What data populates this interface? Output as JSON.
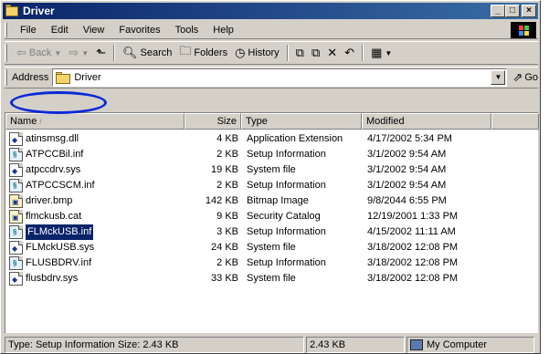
{
  "window": {
    "title": "Driver"
  },
  "title_buttons": {
    "minimize": "_",
    "maximize": "□",
    "close": "×"
  },
  "menu": [
    "File",
    "Edit",
    "View",
    "Favorites",
    "Tools",
    "Help"
  ],
  "toolbar": {
    "back": "Back",
    "search": "Search",
    "folders": "Folders",
    "history": "History"
  },
  "address": {
    "label": "Address",
    "value": "Driver",
    "go": "Go"
  },
  "columns": [
    "Name",
    "Size",
    "Type",
    "Modified"
  ],
  "files": [
    {
      "name": "atinsmsg.dll",
      "size": "4 KB",
      "type": "Application Extension",
      "modified": "4/17/2002 5:34 PM",
      "icon": "dll-icon"
    },
    {
      "name": "ATPCCBil.inf",
      "size": "2 KB",
      "type": "Setup Information",
      "modified": "3/1/2002 9:54 AM",
      "icon": "inf-icon"
    },
    {
      "name": "atpccdrv.sys",
      "size": "19 KB",
      "type": "System file",
      "modified": "3/1/2002 9:54 AM",
      "icon": "sys-icon"
    },
    {
      "name": "ATPCCSCM.inf",
      "size": "2 KB",
      "type": "Setup Information",
      "modified": "3/1/2002 9:54 AM",
      "icon": "inf-icon"
    },
    {
      "name": "driver.bmp",
      "size": "142 KB",
      "type": "Bitmap Image",
      "modified": "9/8/2044 6:55 PM",
      "icon": "bmp-icon"
    },
    {
      "name": "flmckusb.cat",
      "size": "9 KB",
      "type": "Security Catalog",
      "modified": "12/19/2001 1:33 PM",
      "icon": "cat-icon"
    },
    {
      "name": "FLMckUSB.inf",
      "size": "3 KB",
      "type": "Setup Information",
      "modified": "4/15/2002 11:11 AM",
      "icon": "inf-icon",
      "selected": true
    },
    {
      "name": "FLMckUSB.sys",
      "size": "24 KB",
      "type": "System file",
      "modified": "3/18/2002 12:08 PM",
      "icon": "sys-icon"
    },
    {
      "name": "FLUSBDRV.inf",
      "size": "2 KB",
      "type": "Setup Information",
      "modified": "3/18/2002 12:08 PM",
      "icon": "inf-icon"
    },
    {
      "name": "flusbdrv.sys",
      "size": "33 KB",
      "type": "System file",
      "modified": "3/18/2002 12:08 PM",
      "icon": "sys-icon"
    }
  ],
  "status": {
    "info": "Type: Setup Information Size: 2.43 KB",
    "size": "2.43 KB",
    "zone": "My Computer"
  },
  "colors": {
    "titlebar": "#0a246a",
    "selection": "#0a246a",
    "highlight_ring": "#0a28d6",
    "chrome": "#d4d0c8"
  }
}
